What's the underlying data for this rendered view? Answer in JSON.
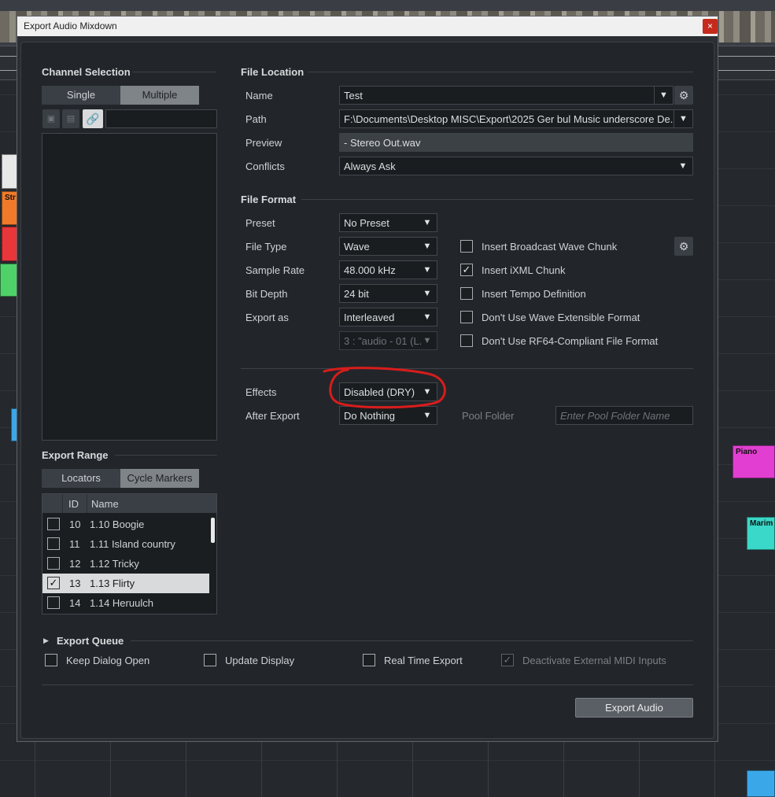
{
  "window": {
    "title": "Export Audio Mixdown",
    "close_glyph": "×"
  },
  "background": {
    "clips": [
      {
        "label": "",
        "color": "#e8e8e8"
      },
      {
        "label": "Str",
        "color": "#f07a2a"
      },
      {
        "label": "",
        "color": "#e8363a"
      },
      {
        "label": "",
        "color": "#4fd16a"
      },
      {
        "label": "",
        "color": "#3aa8e8"
      },
      {
        "label": "Piano",
        "color": "#e23fd2"
      },
      {
        "label": "Marim",
        "color": "#3ad8c8"
      },
      {
        "label": "",
        "color": "#3aa8e8"
      }
    ]
  },
  "channel_selection": {
    "title": "Channel Selection",
    "single_label": "Single",
    "multiple_label": "Multiple",
    "active": "Multiple",
    "search_value": ""
  },
  "export_range": {
    "title": "Export Range",
    "locators_label": "Locators",
    "cycle_markers_label": "Cycle Markers",
    "active": "Cycle Markers",
    "columns": {
      "id": "ID",
      "name": "Name"
    },
    "rows": [
      {
        "id": "10",
        "name": "1.10 Boogie",
        "checked": false,
        "check": ""
      },
      {
        "id": "11",
        "name": "1.11 Island country",
        "checked": false,
        "check": ""
      },
      {
        "id": "12",
        "name": "1.12 Tricky",
        "checked": false,
        "check": ""
      },
      {
        "id": "13",
        "name": "1.13 Flirty",
        "checked": true,
        "check": "✓"
      },
      {
        "id": "14",
        "name": "1.14 Heruulch",
        "checked": false,
        "check": ""
      }
    ]
  },
  "file_location": {
    "title": "File Location",
    "name_label": "Name",
    "name_value": "Test",
    "path_label": "Path",
    "path_value": "F:\\Documents\\Desktop MISC\\Export\\2025 Ger bul Music underscore De.",
    "preview_label": "Preview",
    "preview_value": "- Stereo Out.wav",
    "conflicts_label": "Conflicts",
    "conflicts_value": "Always Ask"
  },
  "file_format": {
    "title": "File Format",
    "preset_label": "Preset",
    "preset_value": "No Preset",
    "file_type_label": "File Type",
    "file_type_value": "Wave",
    "sample_rate_label": "Sample Rate",
    "sample_rate_value": "48.000 kHz",
    "bit_depth_label": "Bit Depth",
    "bit_depth_value": "24 bit",
    "export_as_label": "Export as",
    "export_as_value": "Interleaved",
    "channel_value": "3 : \"audio - 01 (L.",
    "options": [
      {
        "label": "Insert Broadcast Wave Chunk",
        "checked": false,
        "check": ""
      },
      {
        "label": "Insert iXML Chunk",
        "checked": true,
        "check": "✓"
      },
      {
        "label": "Insert Tempo Definition",
        "checked": false,
        "check": ""
      },
      {
        "label": "Don't Use Wave Extensible Format",
        "checked": false,
        "check": ""
      },
      {
        "label": "Don't Use RF64-Compliant File Format",
        "checked": false,
        "check": ""
      }
    ]
  },
  "processing": {
    "effects_label": "Effects",
    "effects_value": "Disabled (DRY)",
    "after_export_label": "After Export",
    "after_export_value": "Do Nothing",
    "pool_folder_label": "Pool Folder",
    "pool_folder_placeholder": "Enter Pool Folder Name"
  },
  "export_queue": {
    "title": "Export Queue",
    "expand_glyph": "▶",
    "keep_dialog_open": {
      "label": "Keep Dialog Open",
      "checked": false
    },
    "update_display": {
      "label": "Update Display",
      "checked": false
    },
    "real_time_export": {
      "label": "Real Time Export",
      "checked": false
    },
    "deactivate_midi": {
      "label": "Deactivate External MIDI Inputs",
      "checked": true,
      "disabled": true,
      "check": "✓"
    }
  },
  "export_button_label": "Export Audio",
  "icons": {
    "dropdown": "▼",
    "gear": "⚙",
    "link": "🔗"
  },
  "annotation": {
    "color": "#d81c1c",
    "target": "effects"
  }
}
